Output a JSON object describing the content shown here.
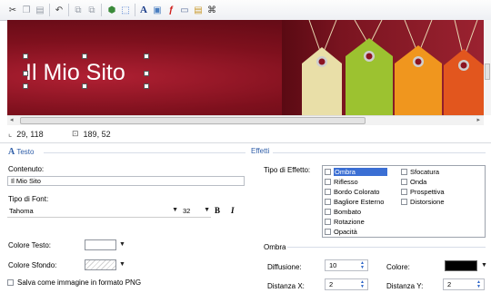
{
  "toolbar": {
    "buttons": [
      {
        "name": "cut-icon",
        "glyph": "✂"
      },
      {
        "name": "copy-icon",
        "glyph": "❐"
      },
      {
        "name": "paste-icon",
        "glyph": "📋"
      },
      {
        "name": "undo-icon",
        "glyph": "↶"
      },
      {
        "name": "bring-forward-icon",
        "glyph": "⧉"
      },
      {
        "name": "send-backward-icon",
        "glyph": "⧉"
      },
      {
        "name": "group-icon",
        "glyph": "⬢"
      },
      {
        "name": "resize-icon",
        "glyph": "⬚"
      },
      {
        "name": "text-tool-icon",
        "glyph": "A"
      },
      {
        "name": "image-tool-icon",
        "glyph": "▣"
      },
      {
        "name": "flash-tool-icon",
        "glyph": "ƒ"
      },
      {
        "name": "shape-tool-icon",
        "glyph": "▭"
      },
      {
        "name": "gallery-icon",
        "glyph": "▤"
      },
      {
        "name": "binoculars-icon",
        "glyph": "⌘"
      }
    ]
  },
  "canvas": {
    "title_text": "Il Mio Sito"
  },
  "status": {
    "position": "29, 118",
    "size": "189, 52"
  },
  "testo": {
    "section_title": "Testo",
    "contenuto_label": "Contenuto:",
    "contenuto_value": "Il Mio Sito",
    "font_label": "Tipo di Font:",
    "font_value": "Tahoma",
    "font_size": "32",
    "bold_label": "B",
    "italic_label": "I",
    "colore_testo_label": "Colore Testo:",
    "colore_sfondo_label": "Colore Sfondo:",
    "save_png_label": "Salva come immagine in formato PNG"
  },
  "effetti": {
    "section_title": "Effetti",
    "tipo_label": "Tipo di Effetto:",
    "options_col1": [
      "Ombra",
      "Riflesso",
      "Bordo Colorato",
      "Bagliore Esterno",
      "Bombato",
      "Rotazione",
      "Opacità"
    ],
    "options_col2": [
      "Sfocatura",
      "Onda",
      "Prospettiva",
      "Distorsione"
    ],
    "selected": "Ombra",
    "ombra_title": "Ombra",
    "diffusione_label": "Diffusione:",
    "diffusione_value": "10",
    "distanza_x_label": "Distanza X:",
    "distanza_x_value": "2",
    "colore_label": "Colore:",
    "distanza_y_label": "Distanza Y:",
    "distanza_y_value": "2"
  },
  "colors": {
    "accent": "#2f5ea8",
    "banner": "#7e101d",
    "shadow_color": "#000000"
  }
}
